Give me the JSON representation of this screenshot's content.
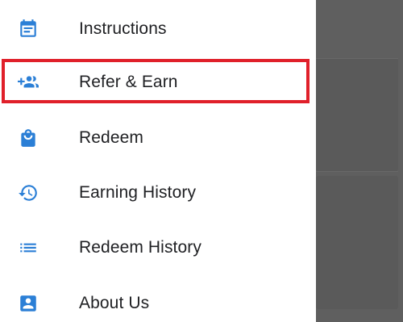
{
  "drawer": {
    "accent_color": "#2b7fd6",
    "highlight_color": "#e0202a",
    "items": [
      {
        "label": "Instructions",
        "icon": "calendar-note-icon"
      },
      {
        "label": "Refer & Earn",
        "icon": "add-people-icon",
        "highlighted": true
      },
      {
        "label": "Redeem",
        "icon": "shopping-bag-icon"
      },
      {
        "label": "Earning History",
        "icon": "history-icon"
      },
      {
        "label": "Redeem History",
        "icon": "list-icon"
      },
      {
        "label": "About Us",
        "icon": "contact-card-icon"
      }
    ]
  }
}
